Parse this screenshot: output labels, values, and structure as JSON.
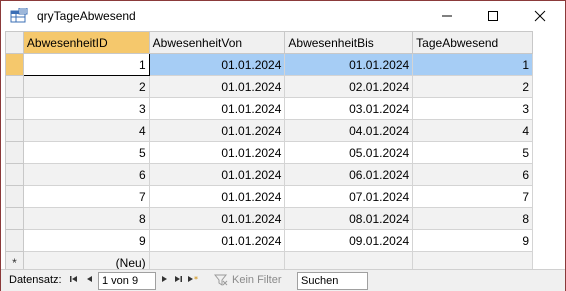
{
  "window": {
    "title": "qryTageAbwesend",
    "icon": "query-icon"
  },
  "columns": [
    "AbwesenheitID",
    "AbwesenheitVon",
    "AbwesenheitBis",
    "TageAbwesend"
  ],
  "rows": [
    {
      "id": "1",
      "von": "01.01.2024",
      "bis": "01.01.2024",
      "tage": "1"
    },
    {
      "id": "2",
      "von": "01.01.2024",
      "bis": "02.01.2024",
      "tage": "2"
    },
    {
      "id": "3",
      "von": "01.01.2024",
      "bis": "03.01.2024",
      "tage": "3"
    },
    {
      "id": "4",
      "von": "01.01.2024",
      "bis": "04.01.2024",
      "tage": "4"
    },
    {
      "id": "5",
      "von": "01.01.2024",
      "bis": "05.01.2024",
      "tage": "5"
    },
    {
      "id": "6",
      "von": "01.01.2024",
      "bis": "06.01.2024",
      "tage": "6"
    },
    {
      "id": "7",
      "von": "01.01.2024",
      "bis": "07.01.2024",
      "tage": "7"
    },
    {
      "id": "8",
      "von": "01.01.2024",
      "bis": "08.01.2024",
      "tage": "8"
    },
    {
      "id": "9",
      "von": "01.01.2024",
      "bis": "09.01.2024",
      "tage": "9"
    }
  ],
  "new_row": {
    "marker": "*",
    "label": "(Neu)"
  },
  "statusbar": {
    "record_label": "Datensatz:",
    "record_position": "1 von 9",
    "filter_label": "Kein Filter",
    "search_placeholder": "Suchen"
  },
  "colors": {
    "window_border": "#8b3a3a",
    "selected_header": "#f5c86c",
    "selected_row": "#a6cdf5",
    "alt_row": "#f2f2f2"
  }
}
